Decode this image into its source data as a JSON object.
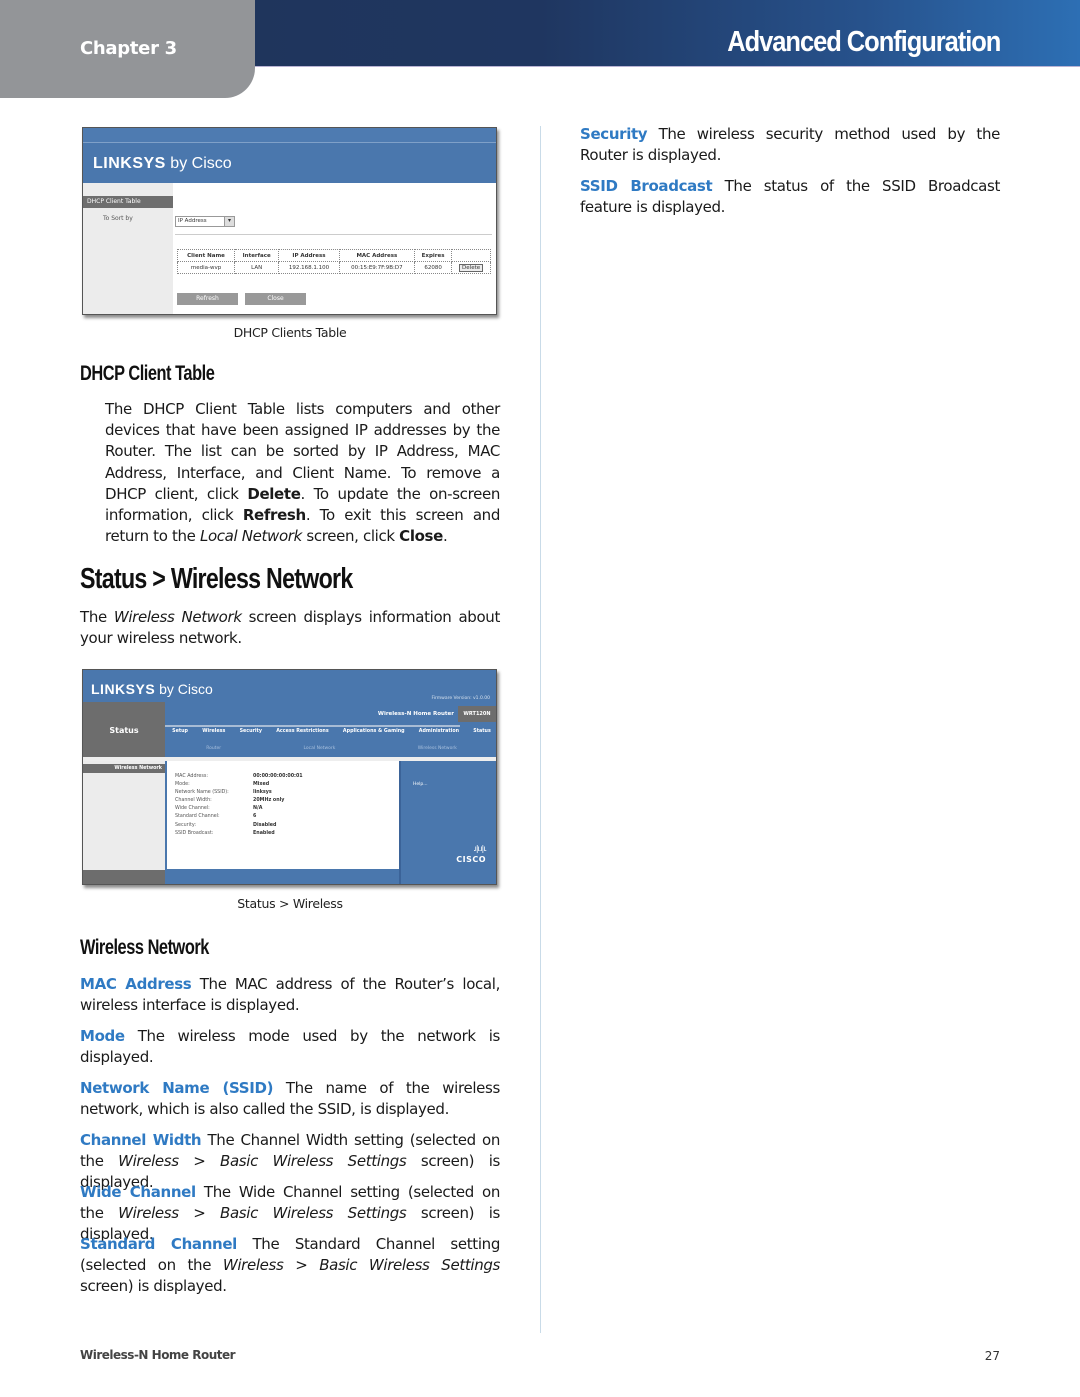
{
  "header": {
    "chapter": "Chapter 3",
    "section": "Advanced Configuration",
    "colors": {
      "bar_dark": "#1f3459",
      "bar_light": "#2d6fb4",
      "chapter_tab": "#939598",
      "term_blue": "#2f7ac3"
    }
  },
  "figure1": {
    "caption": "DHCP Clients Table",
    "logo_brand": "LINKSYS",
    "logo_suffix": "by Cisco",
    "side_heading": "DHCP Client Table",
    "sort_label": "To Sort by",
    "sort_value": "IP Address",
    "table": {
      "columns": [
        "Client Name",
        "Interface",
        "IP Address",
        "MAC Address",
        "Expires",
        ""
      ],
      "rows": [
        [
          "media-wvp",
          "LAN",
          "192.168.1.100",
          "00:15:E9:7F:9B:D7",
          "62080",
          "Delete"
        ]
      ]
    },
    "buttons": {
      "refresh": "Refresh",
      "close": "Close"
    }
  },
  "dhcp_section": {
    "heading": "DHCP Client Table",
    "body": [
      {
        "t": "The DHCP Client Table lists computers and other devices that have been assigned IP addresses by the Router. The list can be sorted by IP Address, MAC Address, Interface, and Client Name. To remove a DHCP client, click "
      },
      {
        "b": "Delete"
      },
      {
        "t": ". To update the on-screen information, click "
      },
      {
        "b": "Refresh"
      },
      {
        "t": ". To exit this screen and return to the "
      },
      {
        "i": "Local Network"
      },
      {
        "t": " screen, click "
      },
      {
        "b": "Close"
      },
      {
        "t": "."
      }
    ]
  },
  "status_section": {
    "heading": "Status > Wireless Network",
    "intro": [
      {
        "t": "The "
      },
      {
        "i": "Wireless Network"
      },
      {
        "t": " screen displays information about your wireless network."
      }
    ]
  },
  "figure2": {
    "caption": "Status > Wireless",
    "logo_brand": "LINKSYS",
    "logo_suffix": "by Cisco",
    "firmware": "Firmware Version: v1.0.00",
    "status_label": "Status",
    "product": "Wireless-N Home Router",
    "model": "WRT120N",
    "tabs": [
      "Setup",
      "Wireless",
      "Security",
      "Access Restrictions",
      "Applications & Gaming",
      "Administration",
      "Status"
    ],
    "subtabs": [
      "Router",
      "Local Network",
      "Wireless Network"
    ],
    "nav_heading": "Wireless Network",
    "fields": [
      "MAC Address:",
      "Mode:",
      "Network Name (SSID):",
      "Channel Width:",
      "Wide Channel:",
      "Standard Channel:",
      "Security:",
      "SSID Broadcast:"
    ],
    "values": [
      "00:00:00:00:00:01",
      "Mixed",
      "linksys",
      "20MHz only",
      "N/A",
      "6",
      "Disabled",
      "Enabled"
    ],
    "help": "Help...",
    "cisco_logo": "CISCO"
  },
  "wireless_section": {
    "heading": "Wireless Network",
    "items": [
      {
        "term": "MAC Address",
        "desc": [
          {
            "t": " The MAC address of the Router’s local, wireless interface is displayed."
          }
        ]
      },
      {
        "term": "Mode",
        "desc": [
          {
            "t": " The wireless mode used by the network is displayed."
          }
        ]
      },
      {
        "term": "Network Name (SSID)",
        "desc": [
          {
            "t": "  The name of the wireless network, which is also called the SSID, is displayed."
          }
        ]
      },
      {
        "term": "Channel Width",
        "desc": [
          {
            "t": "  The Channel Width setting (selected on the "
          },
          {
            "i": "Wireless > Basic Wireless Settings"
          },
          {
            "t": " screen) is displayed."
          }
        ]
      },
      {
        "term": "Wide Channel",
        "desc": [
          {
            "t": "  The Wide Channel setting (selected on the "
          },
          {
            "i": "Wireless > Basic Wireless Settings"
          },
          {
            "t": " screen) is displayed."
          }
        ]
      },
      {
        "term": "Standard Channel",
        "desc": [
          {
            "t": " The Standard Channel setting (selected on the "
          },
          {
            "i": "Wireless > Basic Wireless Settings"
          },
          {
            "t": " screen) is displayed."
          }
        ]
      },
      {
        "term": "Security",
        "desc": [
          {
            "t": "  The wireless security method used by the Router is displayed."
          }
        ]
      },
      {
        "term": "SSID Broadcast",
        "desc": [
          {
            "t": "  The status of the SSID Broadcast feature is displayed."
          }
        ]
      }
    ]
  },
  "footer": {
    "product": "Wireless-N Home Router",
    "page": "27"
  }
}
